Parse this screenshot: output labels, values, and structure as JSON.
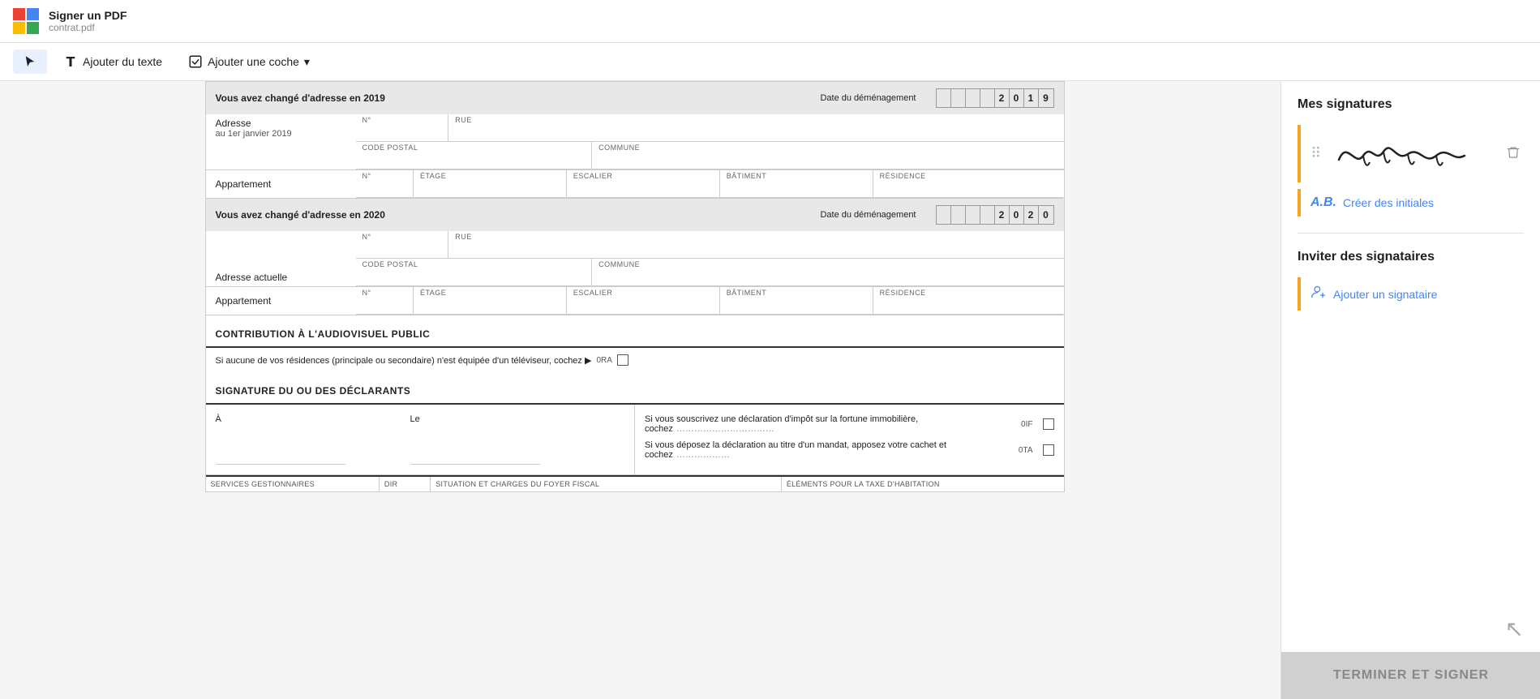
{
  "app": {
    "title": "Signer un PDF",
    "filename": "contrat.pdf"
  },
  "toolbar": {
    "cursor_label": "Curseur",
    "add_text_label": "Ajouter du texte",
    "add_check_label": "Ajouter une coche",
    "dropdown_icon": "▾"
  },
  "pdf": {
    "section1": {
      "change_2019": "Vous avez changé d'adresse en 2019",
      "date_label_2019": "Date du déménagement",
      "date_2019": [
        "",
        "",
        "",
        "",
        "2",
        "0",
        "1",
        "9"
      ],
      "address_label_1": "Adresse",
      "address_sublabel_1": "au 1er janvier 2019",
      "no_label": "N°",
      "rue_label": "RUE",
      "code_postal_label": "CODE POSTAL",
      "commune_label": "COMMUNE",
      "appartement_label": "Appartement",
      "etage_label": "ÉTAGE",
      "escalier_label": "ESCALIER",
      "batiment_label": "BÂTIMENT",
      "residence_label": "RÉSIDENCE"
    },
    "section2": {
      "change_2020": "Vous avez changé d'adresse en 2020",
      "date_label_2020": "Date du déménagement",
      "date_2020": [
        "",
        "",
        "",
        "",
        "2",
        "0",
        "2",
        "0"
      ],
      "adresse_actuelle": "Adresse actuelle",
      "appartement_label": "Appartement"
    },
    "section3": {
      "title": "CONTRIBUTION À L'AUDIOVISUEL PUBLIC",
      "content": "Si aucune de vos résidences (principale ou secondaire) n'est équipée d'un téléviseur, cochez ▶",
      "code": "0RA"
    },
    "section4": {
      "title": "SIGNATURE DU OU DES DÉCLARANTS",
      "a_label": "À",
      "le_label": "Le",
      "check1_text": "Si vous souscrivez une déclaration d'impôt sur la fortune immobilière, cochez",
      "check1_code": "0IF",
      "check2_text": "Si vous déposez la déclaration au titre d'un mandat, apposez votre cachet et cochez",
      "check2_code": "0TA"
    },
    "bottom_table": {
      "services": "SERVICES GESTIONNAIRES",
      "dir": "DIR",
      "situation": "SITUATION ET CHARGES DU FOYER FISCAL",
      "elements": "ÉLÉMENTS POUR LA TAXE D'HABITATION"
    }
  },
  "right_panel": {
    "signatures_title": "Mes signatures",
    "initials_icon": "A.B.",
    "initials_label": "Créer des initiales",
    "invite_title": "Inviter des signataires",
    "invite_label": "Ajouter un signataire"
  },
  "footer": {
    "button_label": "TERMINER ET SIGNER"
  }
}
